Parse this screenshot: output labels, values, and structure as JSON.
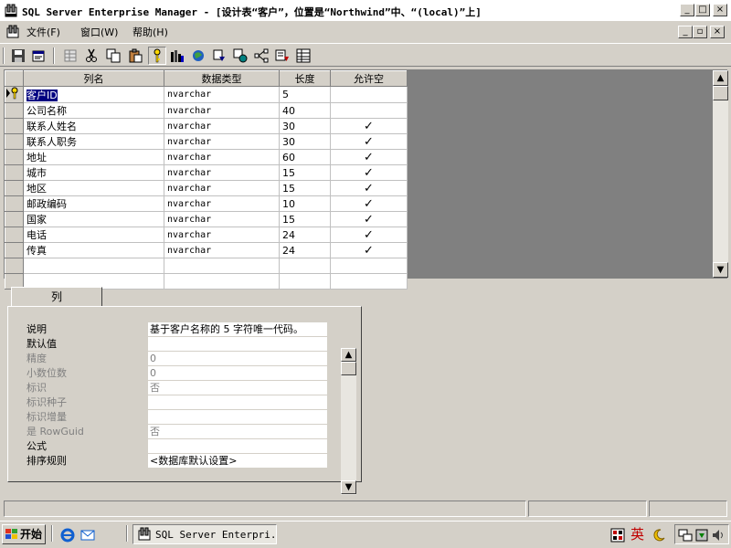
{
  "window": {
    "title": "SQL Server Enterprise Manager - [设计表“客户”，位置是“Northwind”中、“(local)”上]",
    "controls": [
      "_",
      "□",
      "×"
    ]
  },
  "menu": {
    "items": [
      "文件(F)",
      "窗口(W)",
      "帮助(H)"
    ],
    "child_controls": [
      "_",
      "▫",
      "×"
    ]
  },
  "toolbar": {
    "icons": [
      "save-icon",
      "properties-icon",
      "cut-icon",
      "copy-icon",
      "paste-icon",
      "primary-key-icon",
      "manage-indexes-icon",
      "relationships-icon",
      "triggers-icon",
      "permissions-icon",
      "dependencies-icon",
      "generate-script-icon",
      "table-view-icon"
    ]
  },
  "grid": {
    "columns": [
      "列名",
      "数据类型",
      "长度",
      "允许空"
    ],
    "rows": [
      {
        "name": "客户ID",
        "type": "nvarchar",
        "length": "5",
        "nullable": "",
        "key": true,
        "selected": true
      },
      {
        "name": "公司名称",
        "type": "nvarchar",
        "length": "40",
        "nullable": ""
      },
      {
        "name": "联系人姓名",
        "type": "nvarchar",
        "length": "30",
        "nullable": "✓"
      },
      {
        "name": "联系人职务",
        "type": "nvarchar",
        "length": "30",
        "nullable": "✓"
      },
      {
        "name": "地址",
        "type": "nvarchar",
        "length": "60",
        "nullable": "✓"
      },
      {
        "name": "城市",
        "type": "nvarchar",
        "length": "15",
        "nullable": "✓"
      },
      {
        "name": "地区",
        "type": "nvarchar",
        "length": "15",
        "nullable": "✓"
      },
      {
        "name": "邮政编码",
        "type": "nvarchar",
        "length": "10",
        "nullable": "✓"
      },
      {
        "name": "国家",
        "type": "nvarchar",
        "length": "15",
        "nullable": "✓"
      },
      {
        "name": "电话",
        "type": "nvarchar",
        "length": "24",
        "nullable": "✓"
      },
      {
        "name": "传真",
        "type": "nvarchar",
        "length": "24",
        "nullable": "✓"
      }
    ],
    "empty_rows": 2
  },
  "properties": {
    "tab": "列",
    "rows": [
      {
        "label": "说明",
        "value": "基于客户名称的 5 字符唯一代码。",
        "enabled": true
      },
      {
        "label": "默认值",
        "value": "",
        "enabled": true
      },
      {
        "label": "精度",
        "value": "0",
        "enabled": false
      },
      {
        "label": "小数位数",
        "value": "0",
        "enabled": false
      },
      {
        "label": "标识",
        "value": "否",
        "enabled": false
      },
      {
        "label": "标识种子",
        "value": "",
        "enabled": false
      },
      {
        "label": "标识增量",
        "value": "",
        "enabled": false
      },
      {
        "label": "是 RowGuid",
        "value": "否",
        "enabled": false
      },
      {
        "label": "公式",
        "value": "",
        "enabled": true
      },
      {
        "label": "排序规则",
        "value": "<数据库默认设置>",
        "enabled": true
      }
    ]
  },
  "taskbar": {
    "start": "开始",
    "task": "SQL Server Enterpri...",
    "ime": "英"
  },
  "colors": {
    "face": "#d4d0c8",
    "selection": "#000080",
    "accent_red": "#c00000"
  }
}
